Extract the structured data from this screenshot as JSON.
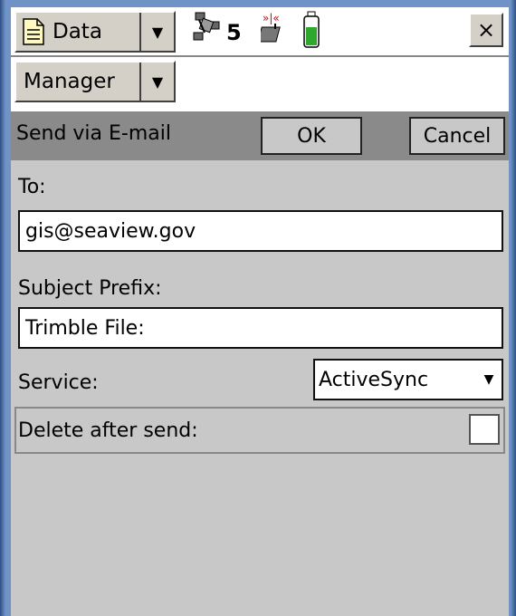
{
  "topbar": {
    "data_menu_label": "Data",
    "satellite_count": "5",
    "close_label": "×"
  },
  "submenu": {
    "manager_label": "Manager"
  },
  "dialog": {
    "title": "Send via E-mail",
    "ok_label": "OK",
    "cancel_label": "Cancel"
  },
  "form": {
    "to_label": "To:",
    "to_value": "gis@seaview.gov",
    "subject_label": "Subject Prefix:",
    "subject_value": "Trimble File:",
    "service_label": "Service:",
    "service_value": "ActiveSync",
    "delete_label": "Delete after send:",
    "delete_checked": false
  },
  "colors": {
    "header_bg": "#8a8a8a",
    "panel_bg": "#c8c8c8",
    "battery_green": "#2fa82f"
  }
}
